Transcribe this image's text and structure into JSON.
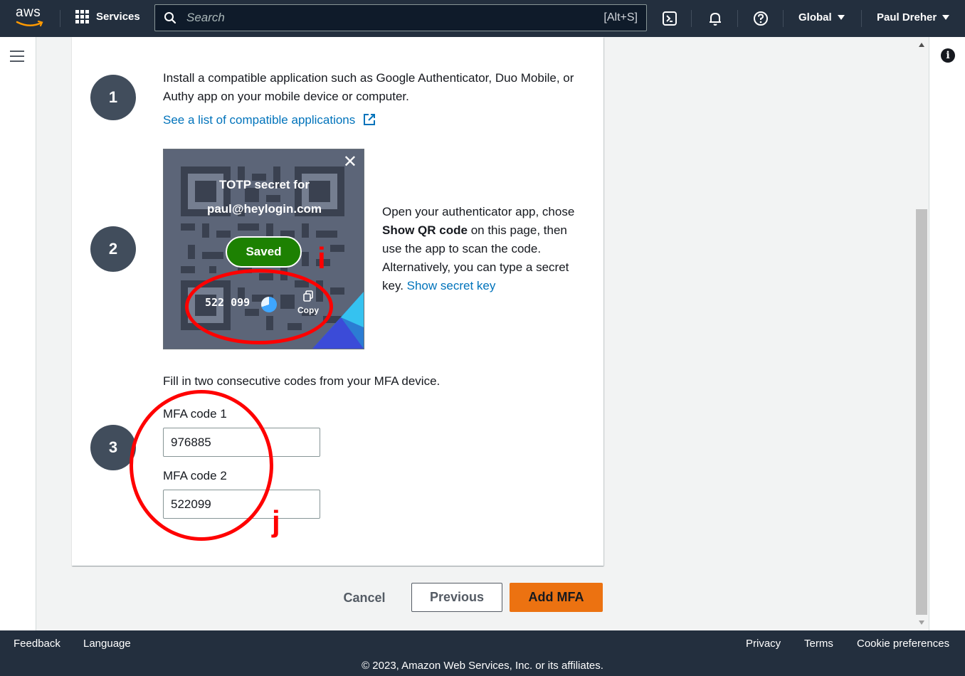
{
  "nav": {
    "logo": "aws",
    "services": "Services",
    "search_placeholder": "Search",
    "search_shortcut": "[Alt+S]",
    "region": "Global",
    "user": "Paul Dreher",
    "icons": [
      "cloudshell-icon",
      "bell-icon",
      "help-icon"
    ]
  },
  "steps": {
    "step1": {
      "number": "1",
      "text": "Install a compatible application such as Google Authenticator, Duo Mobile, or Authy app on your mobile device or computer.",
      "link": "See a list of compatible applications"
    },
    "step2": {
      "number": "2",
      "text_before": "Open your authenticator app, chose ",
      "text_bold": "Show QR code",
      "text_after": " on this page, then use the app to scan the code. Alternatively, you can type a secret key. ",
      "link": "Show secret key"
    },
    "step3": {
      "number": "3",
      "instructions": "Fill in two consecutive codes from your MFA device.",
      "code1_label": "MFA code 1",
      "code1_value": "976885",
      "code2_label": "MFA code 2",
      "code2_value": "522099"
    }
  },
  "totp_popup": {
    "title_line1": "TOTP secret for",
    "title_line2": "paul@heylogin.com",
    "saved": "Saved",
    "code": "522 099",
    "copy": "Copy",
    "close": "✕"
  },
  "annotations": {
    "i": "i",
    "j": "j"
  },
  "actions": {
    "cancel": "Cancel",
    "previous": "Previous",
    "add": "Add MFA"
  },
  "footer": {
    "feedback": "Feedback",
    "language": "Language",
    "privacy": "Privacy",
    "terms": "Terms",
    "cookies": "Cookie preferences",
    "copyright": "© 2023, Amazon Web Services, Inc. or its affiliates."
  },
  "colors": {
    "nav_bg": "#232f3e",
    "primary": "#ec7211",
    "link": "#0073bb",
    "saved_green": "#1d8102",
    "annotation_red": "#ff0000"
  }
}
